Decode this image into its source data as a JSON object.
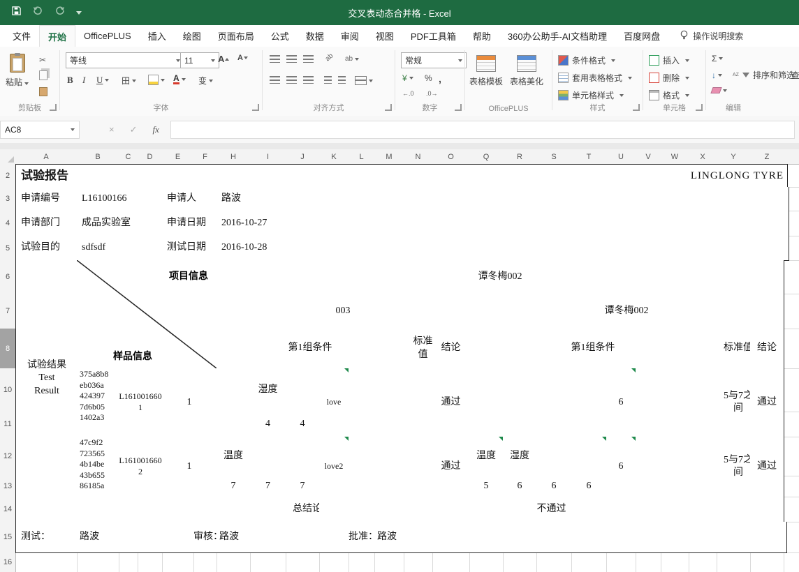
{
  "titlebar": {
    "title": "交叉表动态合并格 - Excel"
  },
  "ribbon": {
    "tabs": [
      "文件",
      "开始",
      "OfficePLUS",
      "插入",
      "绘图",
      "页面布局",
      "公式",
      "数据",
      "审阅",
      "视图",
      "PDF工具箱",
      "帮助",
      "360办公助手-AI文档助理",
      "百度网盘"
    ],
    "tell_me": "操作说明搜索",
    "clipboard": {
      "label": "剪贴板",
      "paste": "粘贴",
      "cut": "✂"
    },
    "font": {
      "label": "字体",
      "name": "等线",
      "size": "11",
      "bold": "B",
      "italic": "I",
      "underline": "U",
      "border": "田",
      "phonetic": "变",
      "grow": "A",
      "shrink": "A"
    },
    "alignment": {
      "label": "对齐方式",
      "wrap": "ab",
      "orient": "ab"
    },
    "number": {
      "label": "数字",
      "format": "常规",
      "currency": "¥",
      "percent": "%",
      "comma": ",",
      "inc": "←.0",
      "dec": ".0→"
    },
    "officeplus": {
      "label": "OfficePLUS",
      "template": "表格模板",
      "beautify": "表格美化"
    },
    "styles": {
      "label": "样式",
      "conditional": "条件格式",
      "table_format": "套用表格格式",
      "cell_styles": "单元格样式"
    },
    "cells": {
      "label": "单元格",
      "insert": "插入",
      "delete": "删除",
      "format": "格式"
    },
    "editing": {
      "label": "编辑",
      "autosum": "Σ",
      "fill": "↓",
      "sort": "排序和筛选",
      "find": "查",
      "az": "AZ"
    }
  },
  "formula_bar": {
    "name_box": "AC8",
    "cancel": "×",
    "enter": "✓",
    "fx": "fx"
  },
  "sheet": {
    "columns": [
      "A",
      "B",
      "C",
      "D",
      "E",
      "F",
      "H",
      "I",
      "J",
      "K",
      "L",
      "M",
      "N",
      "O",
      "Q",
      "R",
      "S",
      "T",
      "U",
      "V",
      "W",
      "X",
      "Y",
      "Z"
    ],
    "rows": [
      "2",
      "3",
      "4",
      "5",
      "6",
      "7",
      "8",
      "10",
      "11",
      "12",
      "13",
      "14",
      "15",
      "16"
    ],
    "cells": {
      "report_title": "试验报告",
      "company": "LINGLONG TYRE",
      "req_no_label": "申请编号",
      "req_no": "L16100166",
      "applicant_label": "申请人",
      "applicant": "路波",
      "dept_label": "申请部门",
      "dept": "成品实验室",
      "req_date_label": "申请日期",
      "req_date": "2016-10-27",
      "purpose_label": "试验目的",
      "purpose": "sdfsdf",
      "test_date_label": "测试日期",
      "test_date": "2016-10-28",
      "project_info": "项目信息",
      "sample_info": "样品信息",
      "test_result": "试验结果\nTest\nResult",
      "batch_top": "谭冬梅002",
      "batch_left": "003",
      "batch_right": "谭冬梅002",
      "group_cond": "第1组条件",
      "std": "标准值",
      "concl": "结论",
      "sample1": {
        "id": "375a8b8\neb036a\n424397\n7d6b05\n1402a3",
        "code": "L1610016601",
        "qty": "1",
        "cond": "湿度",
        "v1": "4",
        "v2": "4",
        "note": "love",
        "pass": "通过",
        "std_value": "6",
        "range": "5与7之间",
        "pass2": "通过"
      },
      "sample2": {
        "id": "47c9f2\n723565\n4b14be\n43b655\n86185a",
        "code": "L1610016602",
        "qty": "1",
        "cond": "温度",
        "v1": "7",
        "v2": "7",
        "v3": "7",
        "note": "love2",
        "pass": "通过",
        "condr1": "温度",
        "condr2": "湿度",
        "r1": "5",
        "r2": "6",
        "r3": "6",
        "r4": "6",
        "std_value": "6",
        "range": "5与7之间",
        "pass2": "通过"
      },
      "summary_label": "总结论",
      "summary_value": "不通过",
      "tester_label": "测试：",
      "tester": "路波",
      "reviewer_label": "审核：",
      "reviewer": "路波",
      "approver_label": "批准：",
      "approver": "路波"
    }
  }
}
